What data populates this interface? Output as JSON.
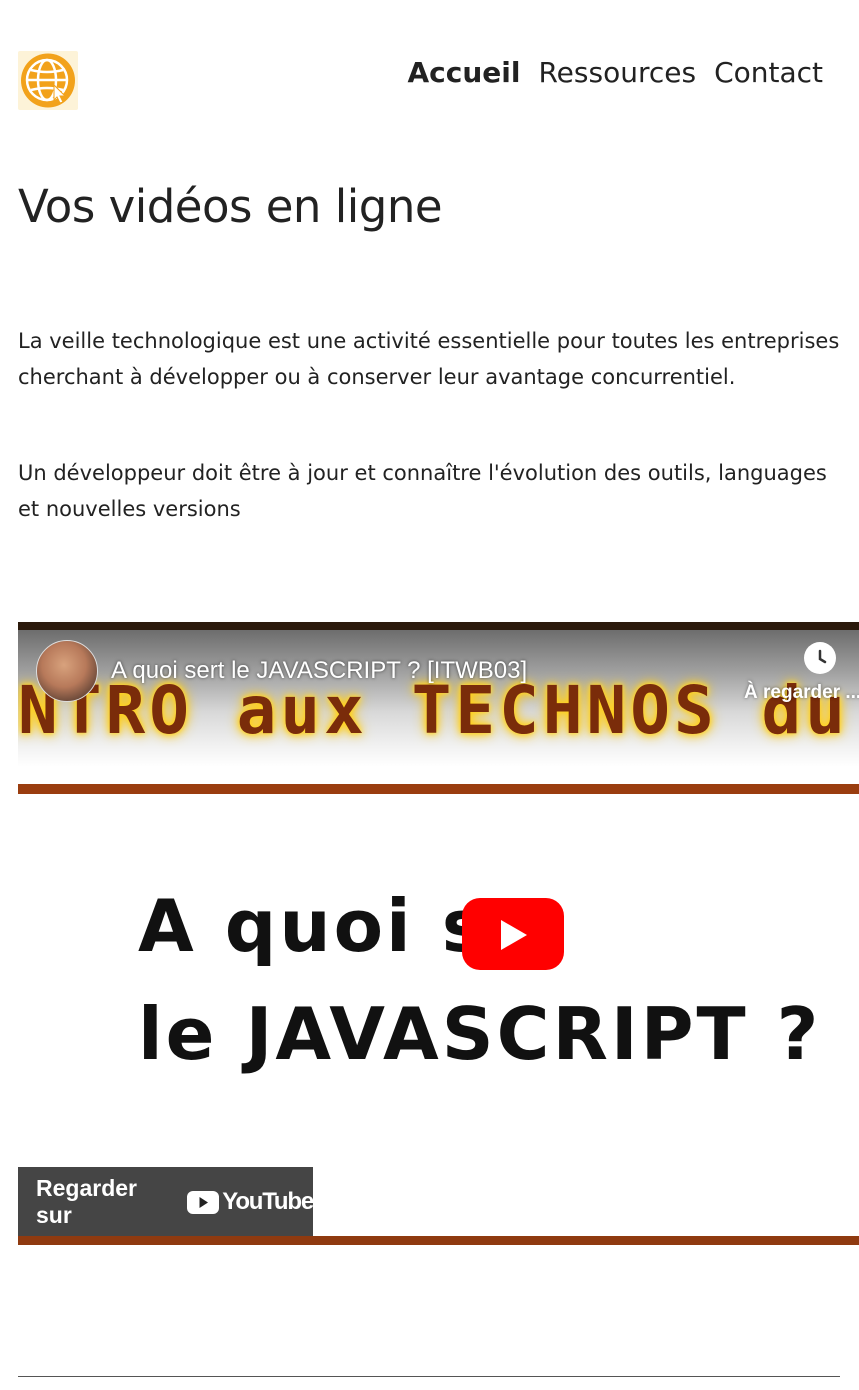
{
  "nav": {
    "items": [
      {
        "label": "Accueil",
        "active": true
      },
      {
        "label": "Ressources",
        "active": false
      },
      {
        "label": "Contact",
        "active": false
      }
    ]
  },
  "logo": {
    "icon": "globe-cursor-icon",
    "color": "#f2a21b"
  },
  "main": {
    "title": "Vos vidéos en ligne",
    "paragraphs": [
      "La veille technologique est une activité essentielle pour toutes les entreprises cherchant à développer ou à conserver leur avantage concurrentiel.",
      "Un développeur doit être à jour et connaître l'évolution des outils, languages et nouvelles versions"
    ]
  },
  "video": {
    "title": "A quoi sert le JAVASCRIPT ? [ITWB03]",
    "watch_later": "À regarder ...",
    "banner_text": "NTRO aux TECHNOS du",
    "thumb_line_1": "A quoi s   t",
    "thumb_line_2": "le JAVASCRIPT ?",
    "watch_on": "Regarder sur",
    "platform": "YouTube",
    "play_color": "#ff0000"
  }
}
